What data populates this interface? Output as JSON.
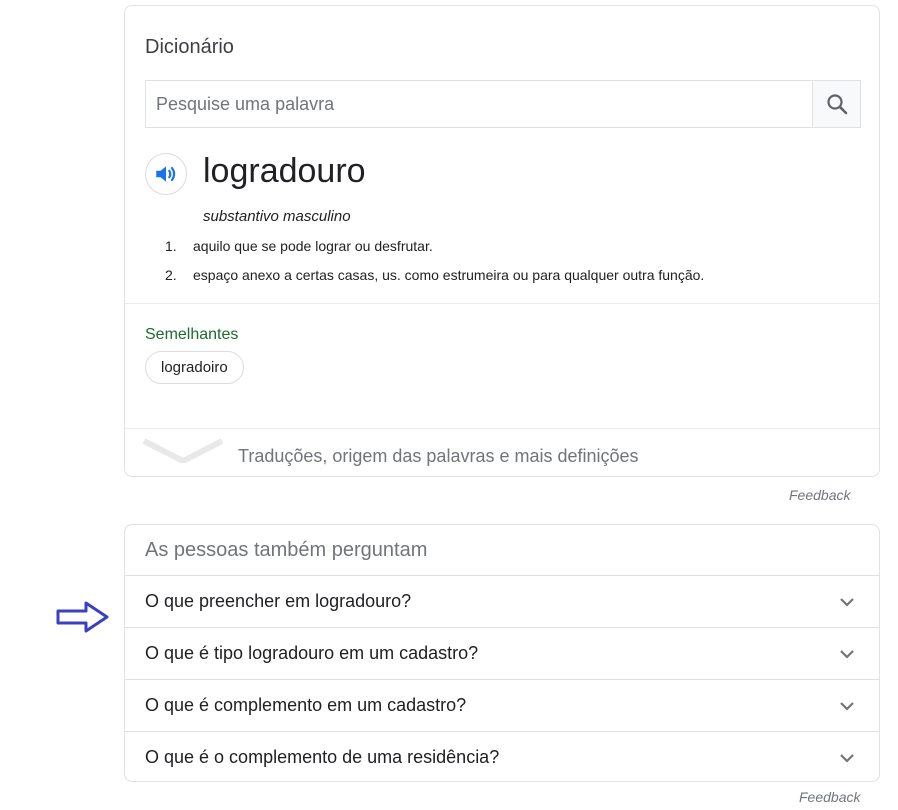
{
  "dictionary": {
    "title": "Dicionário",
    "search_placeholder": "Pesquise uma palavra",
    "search_value": "",
    "headword": "logradouro",
    "word_class": "substantivo masculino",
    "definitions": [
      {
        "num": "1.",
        "text": "aquilo que se pode lograr ou desfrutar."
      },
      {
        "num": "2.",
        "text": "espaço anexo a certas casas, us. como estrumeira ou para qualquer outra função."
      }
    ],
    "similar_label": "Semelhantes",
    "similar_words": [
      "logradoiro"
    ],
    "more_label": "Traduções, origem das palavras e mais definições"
  },
  "feedback_label": "Feedback",
  "paa": {
    "title": "As pessoas também perguntam",
    "questions": [
      "O que preencher em logradouro?",
      "O que é tipo logradouro em um cadastro?",
      "O que é complemento em um cadastro?",
      "O que é o complemento de uma residência?"
    ]
  },
  "colors": {
    "speaker_blue": "#1a73e8",
    "similar_green": "#1e6b2e",
    "annotation_arrow": "#3b3fc2"
  },
  "icons": {
    "search": "magnifier-icon",
    "speaker": "speaker-icon",
    "expand": "chevron-down-icon",
    "annotation": "right-arrow-icon"
  }
}
